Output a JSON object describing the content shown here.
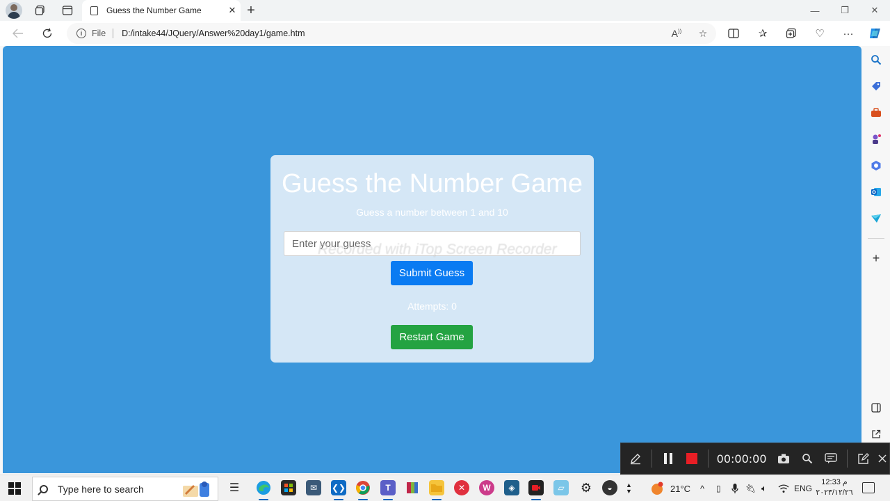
{
  "browser": {
    "tab_title": "Guess the Number Game",
    "tab_close": "✕",
    "new_tab": "+",
    "minimize": "—",
    "restore": "❐",
    "close": "✕",
    "file_label": "File",
    "url": "D:/intake44/JQuery/Answer%20day1/game.htm"
  },
  "game": {
    "title": "Guess the Number Game",
    "subtitle": "Guess a number between 1 and 10",
    "input_placeholder": "Enter your guess",
    "submit_label": "Submit Guess",
    "attempts_text": "Attempts: 0",
    "restart_label": "Restart Game"
  },
  "watermark": "Recorded with iTop Screen Recorder",
  "recorder": {
    "timer": "00:00:00"
  },
  "taskbar": {
    "search_placeholder": "Type here to search",
    "weather": "21°C",
    "language": "ENG",
    "time": "12:33 م",
    "date": "٢٠٢٣/١٢/٢٦"
  },
  "colors": {
    "page_background": "#3a96db",
    "card_background": "#d5e7f6",
    "submit_button": "#0a7bf2",
    "restart_button": "#24a342",
    "stop_button": "#e81e25"
  }
}
